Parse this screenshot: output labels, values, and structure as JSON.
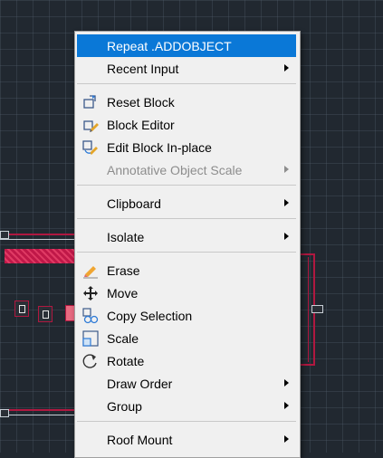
{
  "context_menu": {
    "items": [
      {
        "label": "Repeat .ADDOBJECT",
        "icon": "none",
        "highlighted": true
      },
      {
        "label": "Recent Input",
        "icon": "none",
        "submenu": true
      },
      {
        "label": "Reset Block",
        "icon": "reset-block-icon"
      },
      {
        "label": "Block Editor",
        "icon": "block-editor-icon"
      },
      {
        "label": "Edit Block In-place",
        "icon": "edit-block-in-place-icon"
      },
      {
        "label": "Annotative Object Scale",
        "icon": "none",
        "submenu": true,
        "disabled": true
      },
      {
        "label": "Clipboard",
        "icon": "none",
        "submenu": true
      },
      {
        "label": "Isolate",
        "icon": "none",
        "submenu": true
      },
      {
        "label": "Erase",
        "icon": "eraser-icon"
      },
      {
        "label": "Move",
        "icon": "move-icon"
      },
      {
        "label": "Copy Selection",
        "icon": "copy-icon"
      },
      {
        "label": "Scale",
        "icon": "scale-icon"
      },
      {
        "label": "Rotate",
        "icon": "rotate-icon"
      },
      {
        "label": "Draw Order",
        "icon": "none",
        "submenu": true
      },
      {
        "label": "Group",
        "icon": "none",
        "submenu": true
      },
      {
        "label": "Roof Mount",
        "icon": "none",
        "submenu": true
      }
    ]
  },
  "colors": {
    "canvas_bg": "#212830",
    "menu_bg": "#f0f0f0",
    "highlight": "#0a78d7",
    "cad_red": "#b01840",
    "disabled_text": "#8d8d8d"
  }
}
